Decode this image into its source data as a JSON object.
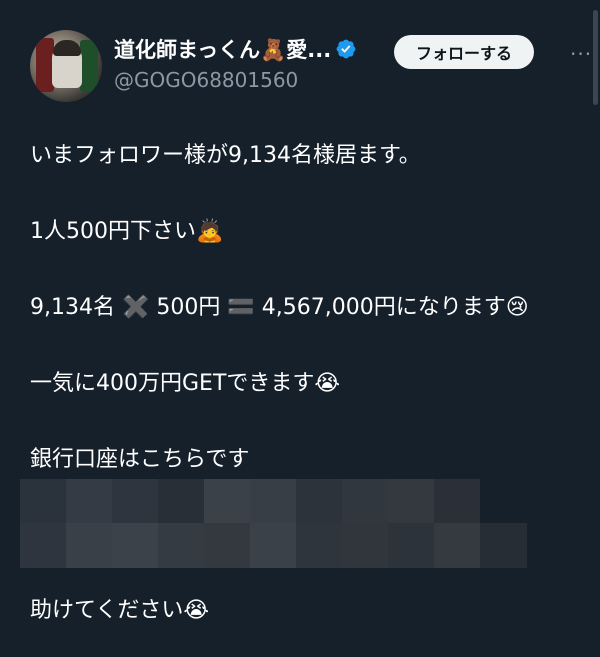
{
  "author": {
    "display_name": "道化師まっくん🧸愛...",
    "handle": "@GOGO68801560",
    "verified": true
  },
  "follow_button": {
    "label": "フォローする"
  },
  "more_button": {
    "label": "···"
  },
  "tweet": {
    "lines": [
      "いまフォロワー様が9,134名様居ます。",
      "1人500円下さい🙇",
      "9,134名 ✖️ 500円 🟰 4,567,000円になります😢",
      "一気に400万円GETできます😭",
      "銀行口座はこちらです",
      "助けてください😭"
    ]
  },
  "colors": {
    "background": "#15202b",
    "text": "#ffffff",
    "secondary_text": "#8b98a5",
    "verified_badge": "#1d9bf0",
    "follow_button_bg": "#eff3f4",
    "follow_button_text": "#0f1419"
  },
  "icons": {
    "verified": "verified-badge-icon",
    "more": "more-icon",
    "avatar": "avatar-image"
  }
}
